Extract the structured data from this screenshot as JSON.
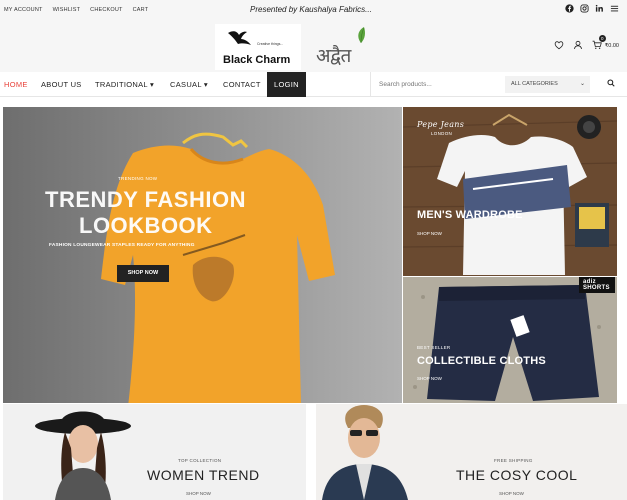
{
  "topbar": {
    "links": [
      "MY ACCOUNT",
      "WISHLIST",
      "CHECKOUT",
      "CART"
    ],
    "tagline": "Presented by Kaushalya Fabrics...",
    "social": [
      "facebook-icon",
      "instagram-icon",
      "linkedin-icon",
      "menu-icon"
    ]
  },
  "logos": {
    "black_charm": {
      "name": "Black Charm",
      "tagline": "Creative things..."
    },
    "adwait": {
      "name": "अद्वैत"
    }
  },
  "header": {
    "cart_count": "0",
    "cart_total": "₹0.00"
  },
  "nav": {
    "items": [
      "HOME",
      "ABOUT US",
      "TRADITIONAL ▾",
      "CASUAL ▾",
      "CONTACT",
      "LOGIN"
    ],
    "search_placeholder": "Search products...",
    "category": "ALL CATEGORIES"
  },
  "hero": {
    "kicker": "TRENDING NOW",
    "title_line1": "TRENDY FASHION",
    "title_line2": "LOOKBOOK",
    "subtitle": "FASHION LOUNGEWEAR STAPLES READY FOR ANYTHING",
    "button": "SHOP NOW"
  },
  "tiles": {
    "men": {
      "brand": "Pepe Jeans",
      "brand_sub": "LONDON",
      "title": "MEN'S WARDROBE",
      "link": "SHOP NOW"
    },
    "cloth": {
      "kicker": "BEST SELLER",
      "title": "COLLECTIBLE CLOTHS",
      "link": "SHOP NOW",
      "badge": "adiz SHORTS"
    }
  },
  "promos": {
    "women": {
      "kicker": "TOP COLLECTION",
      "title": "WOMEN TREND",
      "link": "SHOP NOW"
    },
    "cosy": {
      "kicker": "FREE SHIPPING",
      "title": "THE COSY COOL",
      "link": "SHOP NOW"
    }
  },
  "colors": {
    "accent": "#e8423a",
    "shirt": "#f2a32a",
    "dark": "#222222"
  }
}
